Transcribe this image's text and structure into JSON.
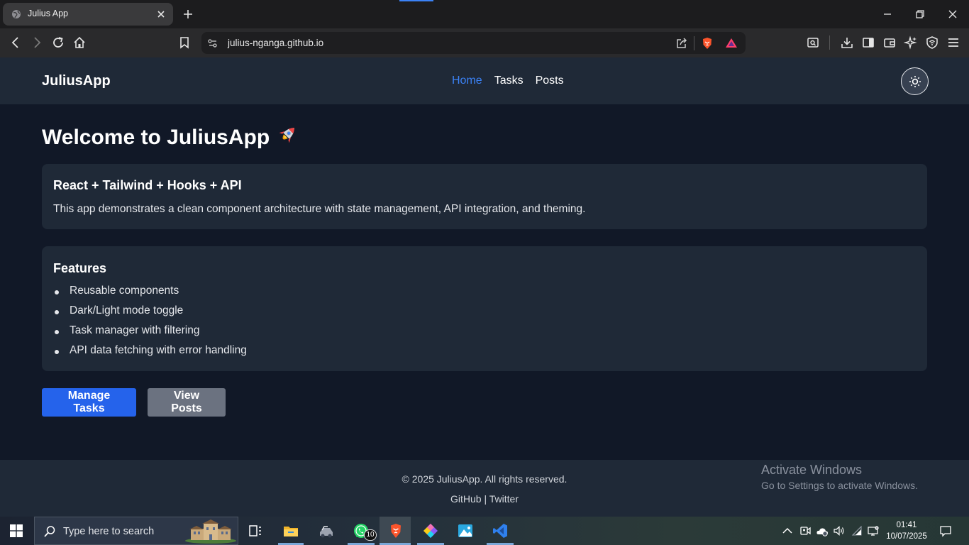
{
  "browser": {
    "tab_title": "Julius App",
    "url": "julius-nganga.github.io"
  },
  "site": {
    "brand": "JuliusApp",
    "nav": [
      "Home",
      "Tasks",
      "Posts"
    ],
    "active_nav": "Home",
    "heading": "Welcome to JuliusApp",
    "intro_card": {
      "title": "React + Tailwind + Hooks + API",
      "text": "This app demonstrates a clean component architecture with state management, API integration, and theming."
    },
    "features_card": {
      "title": "Features",
      "items": [
        "Reusable components",
        "Dark/Light mode toggle",
        "Task manager with filtering",
        "API data fetching with error handling"
      ]
    },
    "buttons": {
      "primary": "Manage Tasks",
      "secondary": "View Posts"
    },
    "footer": {
      "copyright": "© 2025 JuliusApp. All rights reserved.",
      "link_github": "GitHub",
      "separator": "|",
      "link_twitter": "Twitter"
    }
  },
  "watermark": {
    "line1": "Activate Windows",
    "line2": "Go to Settings to activate Windows."
  },
  "taskbar": {
    "search_placeholder": "Type here to search",
    "whatsapp_badge": "10",
    "time": "01:41",
    "date": "10/07/2025"
  },
  "colors": {
    "page_bg": "#111827",
    "surface": "#1f2937",
    "accent": "#3b82f6",
    "primary_button": "#2563eb",
    "secondary_button": "#6b7280"
  }
}
